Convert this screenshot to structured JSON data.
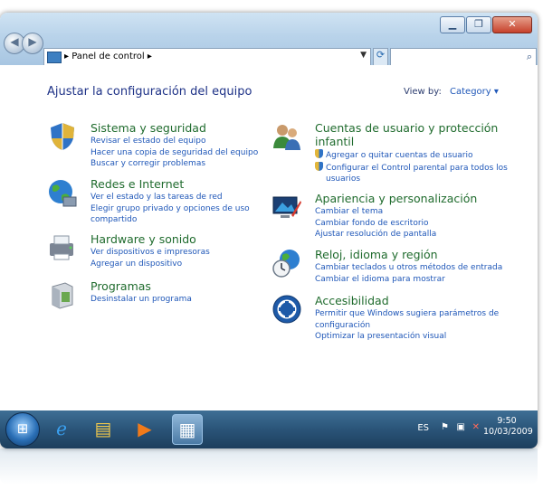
{
  "window": {
    "breadcrumb": "Panel de control",
    "search_placeholder": ""
  },
  "main": {
    "heading": "Ajustar la configuración del equipo",
    "view_by_label": "View by:",
    "view_by_value": "Category"
  },
  "categories_left": [
    {
      "title": "Sistema y seguridad",
      "links": [
        "Revisar el estado del equipo",
        "Hacer una copia de seguridad del equipo",
        "Buscar y corregir problemas"
      ]
    },
    {
      "title": "Redes e Internet",
      "links": [
        "Ver el estado y las tareas de red",
        "Elegir grupo privado y opciones de uso",
        "compartido"
      ]
    },
    {
      "title": "Hardware y sonido",
      "links": [
        "Ver dispositivos e impresoras",
        "Agregar un dispositivo"
      ]
    },
    {
      "title": "Programas",
      "links": [
        "Desinstalar un programa"
      ]
    }
  ],
  "categories_right": [
    {
      "title": "Cuentas de usuario y protección",
      "title2": "infantil",
      "links": [
        "Agregar o quitar cuentas de usuario",
        "Configurar el Control parental para todos los",
        "usuarios"
      ]
    },
    {
      "title": "Apariencia y personalización",
      "links": [
        "Cambiar el tema",
        "Cambiar fondo de escritorio",
        "Ajustar resolución de pantalla"
      ]
    },
    {
      "title": "Reloj, idioma y región",
      "links": [
        "Cambiar teclados u otros métodos de entrada",
        "Cambiar el idioma para mostrar"
      ]
    },
    {
      "title": "Accesibilidad",
      "links": [
        "Permitir que Windows sugiera parámetros de",
        "configuración",
        "Optimizar la presentación visual"
      ]
    }
  ],
  "taskbar": {
    "language": "ES",
    "time": "9:50",
    "date": "10/03/2009"
  },
  "colors": {
    "title_green": "#1f6b2d",
    "link_blue": "#1f57b8",
    "heading_blue": "#1e3287"
  }
}
